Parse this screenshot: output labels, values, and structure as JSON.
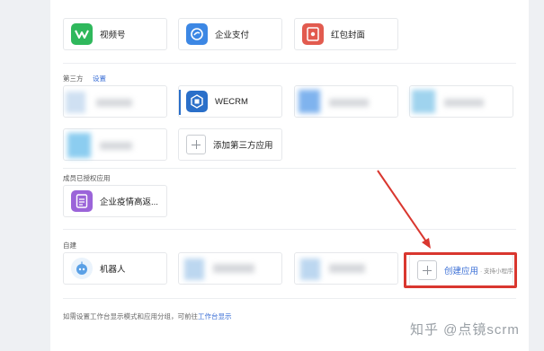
{
  "row1": [
    {
      "label": "视频号",
      "icon": "channels-icon",
      "color": "#2fb85c"
    },
    {
      "label": "企业支付",
      "icon": "payment-icon",
      "color": "#3c87e4"
    },
    {
      "label": "红包封面",
      "icon": "red-envelope-icon",
      "color": "#e25b4f"
    }
  ],
  "third_party": {
    "title": "第三方",
    "settings_link": "设置",
    "wecrm_label": "WECRM",
    "add_label": "添加第三方应用"
  },
  "authorized": {
    "title": "成员已授权应用",
    "app_label": "企业疫情高返..."
  },
  "self_built": {
    "title": "自建",
    "robot_label": "机器人",
    "create_label": "创建应用",
    "create_sub": "· 支持小程序"
  },
  "footer": {
    "text": "如需设置工作台显示模式和应用分组，可前往",
    "link": "工作台显示"
  },
  "watermark": "知乎 @点镜scrm",
  "colors": {
    "accent": "#3b6fd6",
    "highlight": "#d9372f"
  }
}
